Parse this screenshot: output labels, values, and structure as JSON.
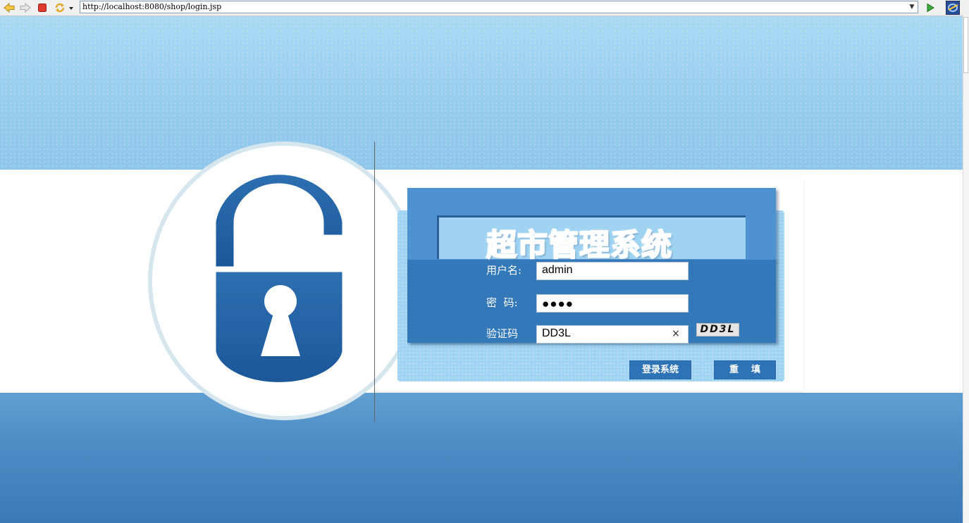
{
  "browser": {
    "url": "http://localhost:8080/shop/login.jsp",
    "toolbar_icons": [
      "back-icon",
      "forward-icon",
      "stop-icon",
      "refresh-icon",
      "menu-dropdown-icon",
      "go-icon",
      "ie-logo-icon"
    ]
  },
  "login": {
    "title": "超市管理系统",
    "username_label": "用户名:",
    "username_value": "admin",
    "password_label": "密  码:",
    "password_value": "●●●●",
    "captcha_label": "验证码",
    "captcha_value": "DD3L",
    "captcha_image_text": "DD3L",
    "clear_glyph": "×",
    "login_button": "登录系统",
    "reset_button": "重    填"
  },
  "colors": {
    "accent_dark": "#3378b8",
    "accent_light": "#4f92d0",
    "sky": "#97cdee",
    "lock_blue": "#2565a3"
  }
}
